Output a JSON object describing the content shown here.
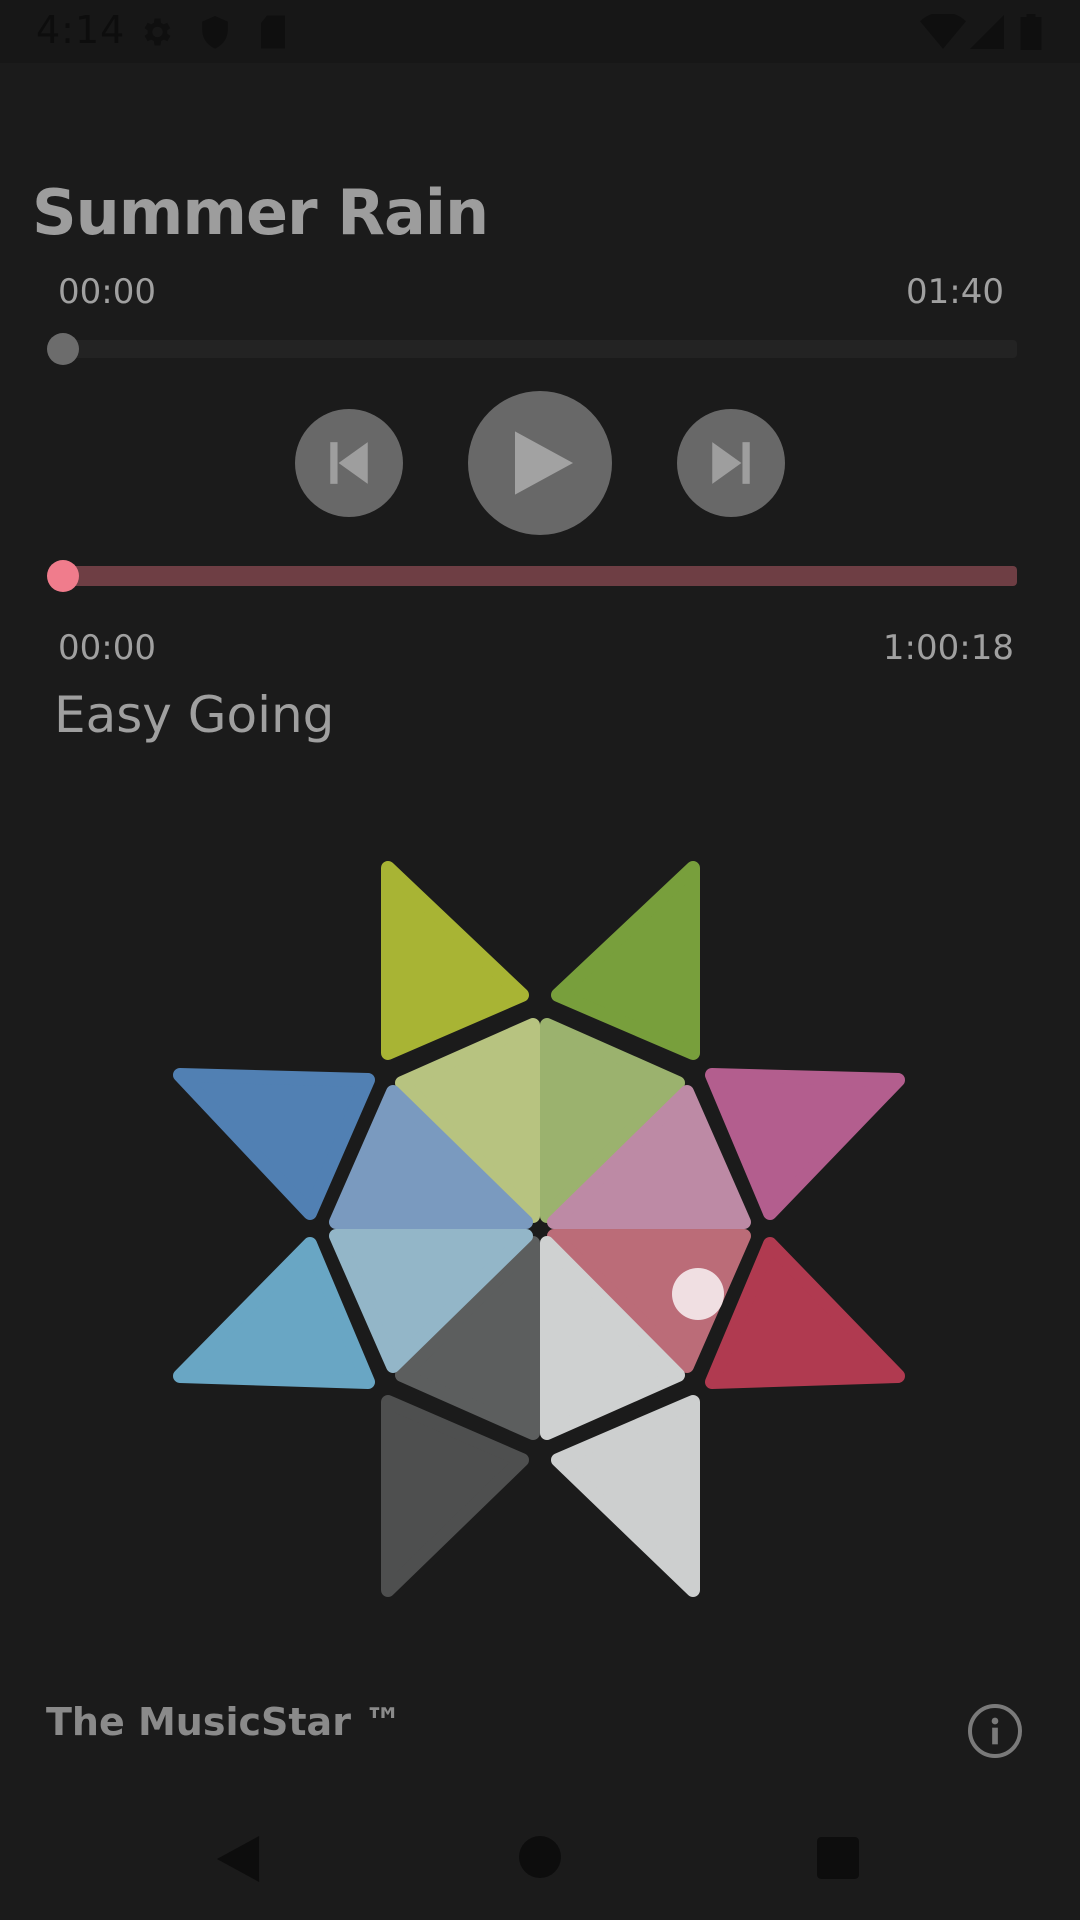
{
  "status_bar": {
    "time": "4:14",
    "icons": [
      "gear-icon",
      "shield-icon",
      "sd-card-icon",
      "wifi-icon",
      "cell-signal-icon",
      "battery-icon"
    ]
  },
  "track": {
    "title": "Summer Rain",
    "elapsed": "00:00",
    "duration": "01:40",
    "progress": 0
  },
  "controls": {
    "prev": "skip-previous-icon",
    "play": "play-icon",
    "next": "skip-next-icon"
  },
  "session": {
    "elapsed": "00:00",
    "duration": "1:00:18",
    "progress": 0,
    "accent_color": "#f07c8c",
    "track_color": "#6e3e44"
  },
  "mood": {
    "label": "Easy Going",
    "selected_segment": "inner-pink"
  },
  "star_colors": {
    "outer_yellow_green": "#a8b434",
    "outer_green": "#789f3c",
    "outer_magenta": "#b35e8e",
    "outer_red": "#b03a50",
    "outer_light_gray": "#cdcfcf",
    "outer_dark_gray": "#4e4f4f",
    "outer_sky_blue": "#69a6c4",
    "outer_blue": "#5180b3",
    "inner_light_yellow_green": "#b7c380",
    "inner_light_green": "#9bb26e",
    "inner_light_pink": "#bd8aa5",
    "inner_pink": "#bb6c78",
    "inner_white": "#cfd1d1",
    "inner_mid_gray": "#5c5e5e",
    "inner_pale_blue": "#93b6c8",
    "inner_steel_blue": "#7a9abf"
  },
  "footer": {
    "brand": "The MusicStar ™",
    "info": "info-icon"
  },
  "nav": {
    "back": "back-icon",
    "home": "home-icon",
    "recents": "recents-icon"
  }
}
